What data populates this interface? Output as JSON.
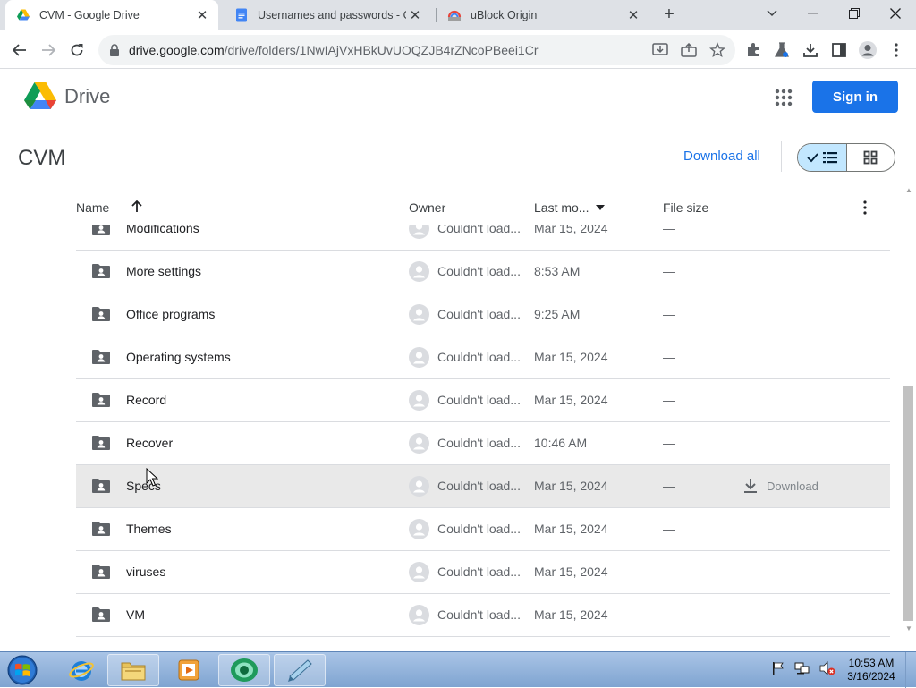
{
  "browser": {
    "tabs": [
      {
        "title": "CVM - Google Drive",
        "icon": "google-drive-icon",
        "active": true
      },
      {
        "title": "Usernames and passwords - Goo",
        "icon": "google-docs-icon",
        "active": false
      },
      {
        "title": "uBlock Origin",
        "icon": "ublock-icon",
        "active": false
      }
    ],
    "close_symbol": "✕",
    "new_tab_symbol": "+",
    "url_host": "drive.google.com",
    "url_path": "/drive/folders/1NwIAjVxHBkUvUOQZJB4rZNcoPBeei1Cr"
  },
  "drive": {
    "product_name": "Drive",
    "sign_in_label": "Sign in",
    "folder_title": "CVM",
    "download_all_label": "Download all",
    "columns": {
      "name": "Name",
      "owner": "Owner",
      "last_modified": "Last mo...",
      "file_size": "File size"
    },
    "rows": [
      {
        "name": "Modifications",
        "owner": "Couldn't load...",
        "modified": "Mar 15, 2024",
        "size": "—"
      },
      {
        "name": "More settings",
        "owner": "Couldn't load...",
        "modified": "8:53 AM",
        "size": "—"
      },
      {
        "name": "Office programs",
        "owner": "Couldn't load...",
        "modified": "9:25 AM",
        "size": "—"
      },
      {
        "name": "Operating systems",
        "owner": "Couldn't load...",
        "modified": "Mar 15, 2024",
        "size": "—"
      },
      {
        "name": "Record",
        "owner": "Couldn't load...",
        "modified": "Mar 15, 2024",
        "size": "—"
      },
      {
        "name": "Recover",
        "owner": "Couldn't load...",
        "modified": "10:46 AM",
        "size": "—"
      },
      {
        "name": "Specs",
        "owner": "Couldn't load...",
        "modified": "Mar 15, 2024",
        "size": "—",
        "hover": true
      },
      {
        "name": "Themes",
        "owner": "Couldn't load...",
        "modified": "Mar 15, 2024",
        "size": "—"
      },
      {
        "name": "viruses",
        "owner": "Couldn't load...",
        "modified": "Mar 15, 2024",
        "size": "—"
      },
      {
        "name": "VM",
        "owner": "Couldn't load...",
        "modified": "Mar 15, 2024",
        "size": "—"
      }
    ],
    "row_download_label": "Download"
  },
  "taskbar": {
    "time": "10:53 AM",
    "date": "3/16/2024"
  },
  "colors": {
    "accent": "#1a73e8",
    "tabstrip": "#dee1e6",
    "row_hover": "#e9e9e9"
  }
}
